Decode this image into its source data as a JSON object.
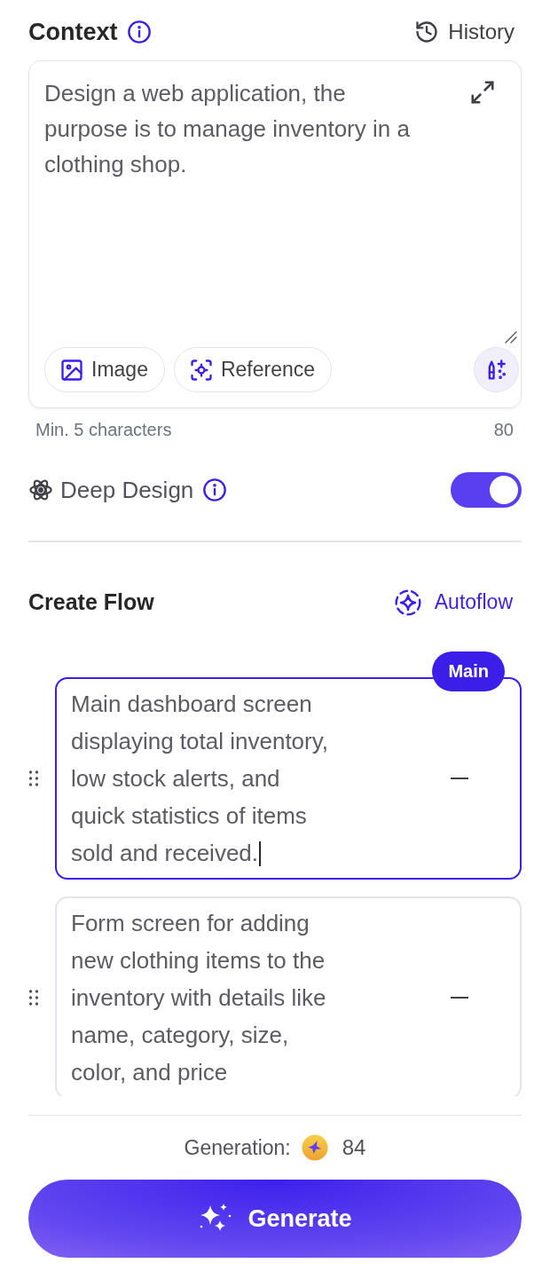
{
  "header": {
    "title": "Context",
    "history": "History"
  },
  "context": {
    "value": "Design a web application, the purpose is to manage inventory in a clothing shop.",
    "attachments": [
      {
        "kind": "image",
        "label": "Image"
      },
      {
        "kind": "reference",
        "label": "Reference"
      }
    ],
    "hint": "Min. 5 characters",
    "count": "80"
  },
  "deep_design": {
    "label": "Deep Design",
    "on": true
  },
  "flow": {
    "title": "Create Flow",
    "autoflow": "Autoflow",
    "steps": [
      {
        "text": "Main dashboard screen displaying total inventory, low stock alerts, and quick statistics of items sold and received.",
        "badge": "Main",
        "focused": true
      },
      {
        "text": "Form screen for adding new clothing items to the inventory with details like name, category, size, color, and price",
        "focused": false
      }
    ]
  },
  "footer": {
    "generation_label": "Generation:",
    "credits": "84",
    "button": "Generate"
  }
}
